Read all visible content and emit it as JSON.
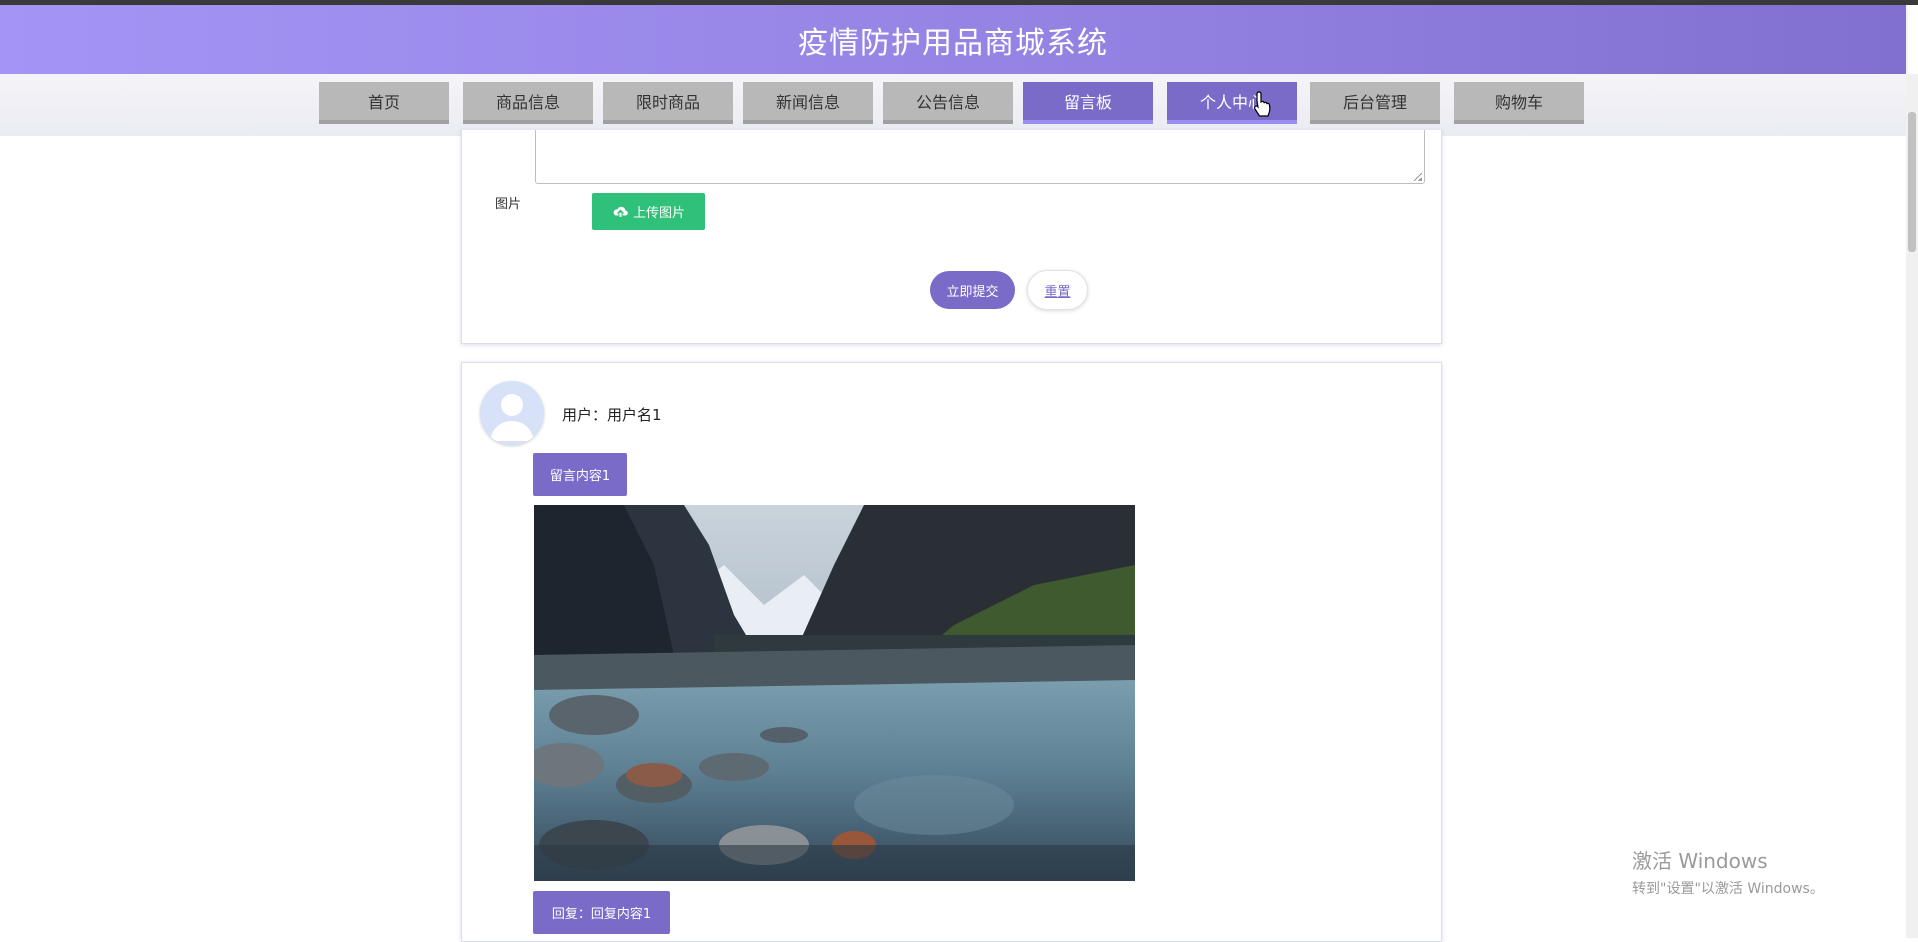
{
  "app": {
    "title": "疫情防护用品商城系统"
  },
  "nav": {
    "items": [
      {
        "label": "首页",
        "active": false
      },
      {
        "label": "商品信息",
        "active": false
      },
      {
        "label": "限时商品",
        "active": false
      },
      {
        "label": "新闻信息",
        "active": false
      },
      {
        "label": "公告信息",
        "active": false
      },
      {
        "label": "留言板",
        "active": true
      },
      {
        "label": "个人中心",
        "active": true
      },
      {
        "label": "后台管理",
        "active": false
      },
      {
        "label": "购物车",
        "active": false
      }
    ]
  },
  "form": {
    "content_value": "",
    "image_label": "图片",
    "upload_label": "上传图片",
    "submit_label": "立即提交",
    "reset_label": "重置"
  },
  "message": {
    "user_line": "用户：用户名1",
    "content": "留言内容1",
    "reply": "回复：回复内容1"
  },
  "watermark": {
    "title": "激活 Windows",
    "subtitle": "转到\"设置\"以激活 Windows。"
  },
  "colors": {
    "primary": "#7b6bc9",
    "header_start": "#a394f5",
    "header_end": "#8270d0",
    "upload_green": "#2fc07a",
    "nav_inactive": "#b8b8b8"
  },
  "icons": {
    "upload": "cloud-upload-icon",
    "avatar": "user-avatar-icon",
    "cursor": "hand-pointer-icon"
  }
}
